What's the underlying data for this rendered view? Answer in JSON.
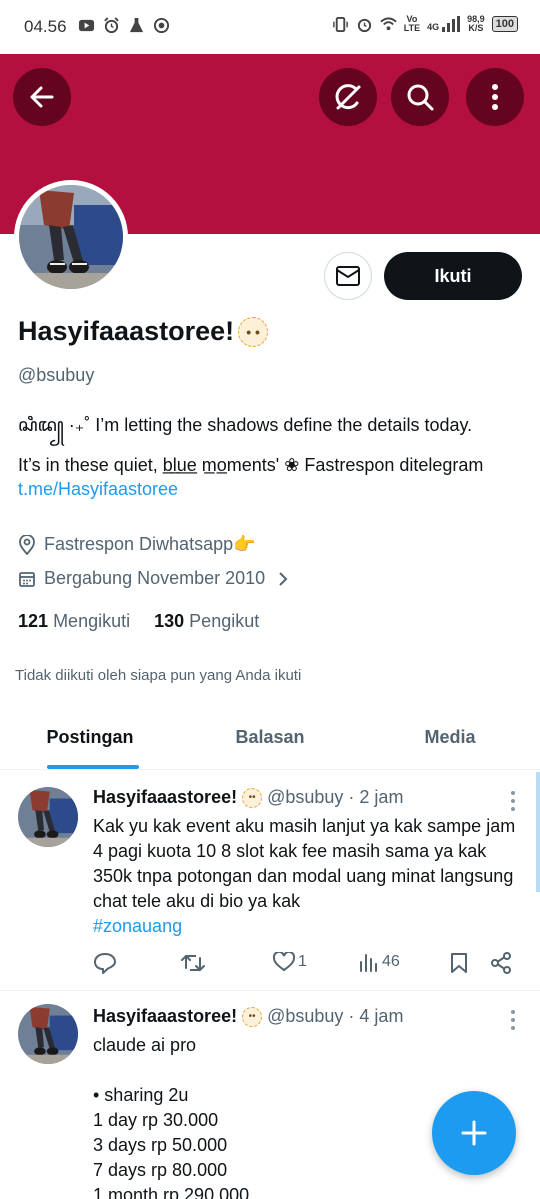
{
  "status_bar": {
    "time": "04.56",
    "network_top": "Vo",
    "network_bottom": "LTE",
    "network_type": "4G",
    "speed_top": "98,9",
    "speed_bottom": "K/S",
    "battery": "100"
  },
  "profile": {
    "display_name": "Hasyifaaastoree!",
    "handle": "@bsubuy",
    "bio_line1": "ꦱꦶꦢ꧀ ·₊˚  I’m letting the shadows define the details today.",
    "bio_line2": "It’s in these quiet, b̲l̲u̲e̲ m̲o̲ments' ❀ Fastrespon  ditelegram",
    "bio_link": "t.me/Hasyifaastoree",
    "location": "Fastrespon Diwhatsapp👉",
    "joined": "Bergabung November 2010",
    "following_count": "121",
    "following_label": "Mengikuti",
    "followers_count": "130",
    "followers_label": "Pengikut",
    "followers_note": "Tidak diikuti oleh siapa pun yang Anda ikuti",
    "follow_button": "Ikuti"
  },
  "tabs": [
    {
      "label": "Postingan"
    },
    {
      "label": "Balasan"
    },
    {
      "label": "Media"
    }
  ],
  "posts": [
    {
      "name": "Hasyifaaastoree!",
      "handle": "@bsubuy",
      "time": "· 2 jam",
      "text": "Kak yu kak event aku masih lanjut ya kak sampe jam 4 pagi kuota 10 8 slot kak fee masih sama ya kak 350k tnpa potongan dan modal uang minat langsung chat tele aku di bio ya kak",
      "hashtag": "#zonauang",
      "likes": "1",
      "views": "46"
    },
    {
      "name": "Hasyifaaastoree!",
      "handle": "@bsubuy",
      "time": "· 4 jam",
      "text": "claude ai pro\n\n• sharing 2u\n1 day rp 30.000\n3 days rp 50.000\n7 days rp 80.000\n1 month rp 290.000"
    }
  ],
  "icons": {
    "back": "arrow-left-icon",
    "grok": "grok-icon",
    "search": "search-icon",
    "more": "more-vertical-icon",
    "mail": "mail-icon",
    "location": "location-pin-icon",
    "calendar": "calendar-icon",
    "compose": "plus-icon"
  },
  "colors": {
    "banner": "#b3103f",
    "accent": "#1d9bf0",
    "text_primary": "#0f1419",
    "text_secondary": "#536471"
  }
}
